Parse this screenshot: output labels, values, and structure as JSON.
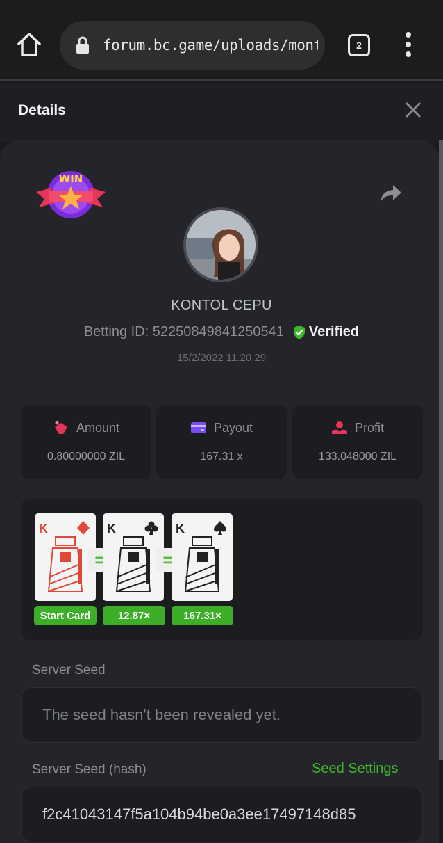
{
  "browser": {
    "url": "forum.bc.game/uploads/monthly.",
    "tab_count": "2"
  },
  "details": {
    "title": "Details"
  },
  "player": {
    "name": "KONTOL CEPU",
    "betting_id": "Betting ID: 52250849841250541",
    "verified_label": "Verified",
    "time": "15/2/2022 11.20.29",
    "badge_text": "WIN"
  },
  "stats": {
    "amount": {
      "label": "Amount",
      "value": "0.80000000 ZIL"
    },
    "payout": {
      "label": "Payout",
      "value": "167.31 x"
    },
    "profit": {
      "label": "Profit",
      "value": "133.048000 ZIL"
    }
  },
  "game": {
    "cards": [
      {
        "rank": "K",
        "suit": "diamond",
        "color": "#e0493a"
      },
      {
        "rank": "K",
        "suit": "club",
        "color": "#222222"
      },
      {
        "rank": "K",
        "suit": "spade",
        "color": "#222222"
      }
    ],
    "multipliers": [
      "Start Card",
      "12.87×",
      "167.31×"
    ],
    "eq_symbol": "="
  },
  "seeds": {
    "server_seed_label": "Server Seed",
    "server_seed_value": "The seed hasn't been revealed yet.",
    "server_hash_label": "Server Seed (hash)",
    "seed_settings_link": "Seed Settings",
    "server_hash_value": "f2c41043147f5a104b94be0a3ee17497148d85"
  },
  "colors": {
    "accent_green": "#3eb82a",
    "panel": "#24252a",
    "card_red": "#e0493a"
  }
}
